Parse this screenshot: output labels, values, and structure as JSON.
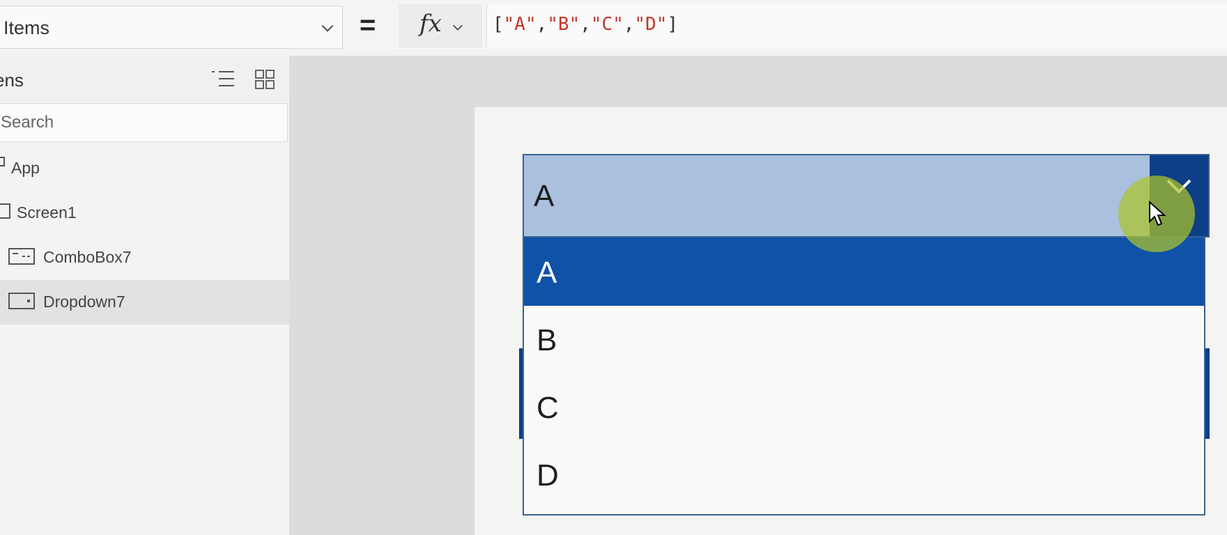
{
  "formula_bar": {
    "property": "Items",
    "equals": "=",
    "fx": "fx",
    "formula_parts": [
      "[",
      "\"A\"",
      ",",
      "\"B\"",
      ",",
      "\"C\"",
      ",",
      "\"D\"",
      "]"
    ]
  },
  "tree": {
    "title": "ens",
    "search_placeholder": "Search",
    "items": [
      {
        "label": "App"
      },
      {
        "label": "Screen1"
      },
      {
        "label": "ComboBox7"
      },
      {
        "label": "Dropdown7"
      }
    ]
  },
  "dropdown": {
    "selected": "A",
    "options": [
      "A",
      "B",
      "C",
      "D"
    ],
    "highlighted_option": "A"
  },
  "colors": {
    "dropdown_field": "#a9c1df",
    "dropdown_chevron_bg": "#0c3f86",
    "highlighted_option": "#0f52a8",
    "formula_string": "#c0392b",
    "cursor_highlight": "#acc42a"
  }
}
